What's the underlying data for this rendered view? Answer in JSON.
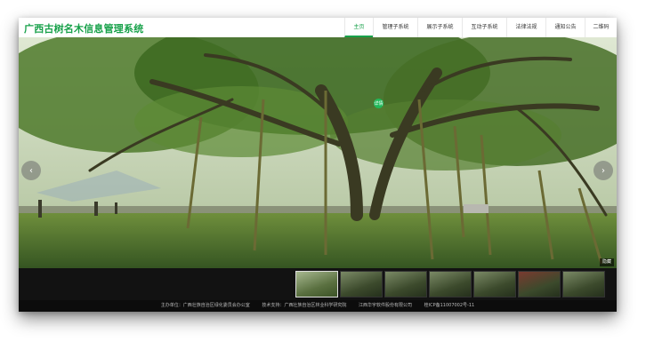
{
  "header": {
    "site_title": "广西古树名木信息管理系统",
    "nav": [
      {
        "label": "主页",
        "active": true
      },
      {
        "label": "管理子系统",
        "active": false
      },
      {
        "label": "展示子系统",
        "active": false
      },
      {
        "label": "互动子系统",
        "active": false
      },
      {
        "label": "法律法规",
        "active": false
      },
      {
        "label": "通知公告",
        "active": false
      },
      {
        "label": "二维码",
        "active": false
      }
    ]
  },
  "hero": {
    "prev_icon": "chevron-left-icon",
    "next_icon": "chevron-right-icon",
    "hotspot_label": "详情",
    "hide_label": "隐藏"
  },
  "thumbnails": {
    "count": 7,
    "active_index": 0
  },
  "footer": {
    "sponsor": "主办单位：广西壮族自治区绿化委员会办公室",
    "tech_support": "技术支持：广西壮族自治区林业科学研究院",
    "company": "江西华宇软件股份有限公司",
    "icp": "桂ICP备11007002号-11"
  },
  "colors": {
    "accent": "#18a14a"
  }
}
